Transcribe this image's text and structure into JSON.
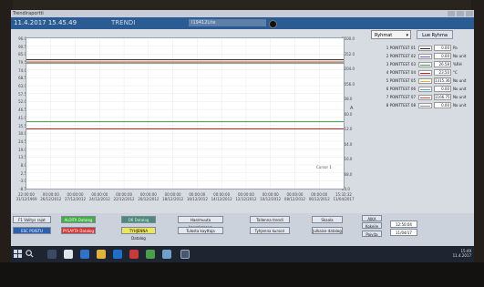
{
  "window": {
    "title": "Trendiraportti"
  },
  "header": {
    "datetime": "11.4.2017  15.45.49",
    "title": "TRENDI",
    "tag": "I19412Lite"
  },
  "controls": {
    "select_label": "Ryhmat",
    "select_arrow": "▾",
    "top_button": "Lue Ryhma"
  },
  "chart_data": {
    "type": "line",
    "title": "",
    "y_left_ticks": [
      "96.0",
      "90.5",
      "85.0",
      "79.5",
      "74.0",
      "68.5",
      "63.0",
      "57.5",
      "52.0",
      "46.5",
      "41.0",
      "35.5",
      "30.0",
      "24.5",
      "19.0",
      "13.5",
      "8.0",
      "2.5",
      "-3.0",
      "-8.5"
    ],
    "y_right_ticks": [
      "1500.0",
      "1352.0",
      "1204.0",
      "1056.0",
      "908.0",
      "760.0",
      "612.0",
      "464.0",
      "316.0",
      "168.0",
      "20.0"
    ],
    "x_ticks": [
      [
        "22:00:00",
        "31/12/1969"
      ],
      [
        "00:00:00",
        "26/12/2012"
      ],
      [
        "00:00:00",
        "27/12/2012"
      ],
      [
        "00:00:00",
        "24/12/2012"
      ],
      [
        "00:00:00",
        "22/12/2012"
      ],
      [
        "00:00:00",
        "20/12/2012"
      ],
      [
        "00:00:00",
        "18/12/2012"
      ],
      [
        "00:00:00",
        "16/12/2012"
      ],
      [
        "00:00:00",
        "14/12/2012"
      ],
      [
        "00:00:00",
        "12/12/2012"
      ],
      [
        "00:00:00",
        "10/12/2012"
      ],
      [
        "00:00:00",
        "08/12/2012"
      ],
      [
        "00:00:00",
        "06/12/2012"
      ],
      [
        "15:32:32",
        "11/04/2017"
      ]
    ],
    "y_axis_side_label": "A",
    "cursor_label": "Cursor 1",
    "series": [
      {
        "color": "#222222",
        "y_level": 81.0
      },
      {
        "color": "#d24a3a",
        "y_level": 79.5
      },
      {
        "color": "#e5b23a",
        "y_level": 79.0
      },
      {
        "color": "#5aa0d0",
        "y_level": 78.5
      },
      {
        "color": "#3f9f3f",
        "y_level": 38.0
      },
      {
        "color": "#c81e1e",
        "y_level": 33.0
      }
    ]
  },
  "legend": [
    {
      "name": "1 POINTTEST 01",
      "value": "0.00",
      "unit": "Pa",
      "color": "#2a2a2a"
    },
    {
      "name": "2 POINTTEST 02",
      "value": "0.00",
      "unit": "No unit",
      "color": "#6b4fd0"
    },
    {
      "name": "3 POINTTEST 03",
      "value": "26.58",
      "unit": "%RH",
      "color": "#3f9f3f"
    },
    {
      "name": "4 POINTTEST 04",
      "value": "23.50",
      "unit": "°C",
      "color": "#c81e1e"
    },
    {
      "name": "5 POINTTEST 05",
      "value": "1315.36",
      "unit": "No unit",
      "color": "#e5b23a"
    },
    {
      "name": "6 POINTTEST 06",
      "value": "0.00",
      "unit": "No unit",
      "color": "#4aa0d0"
    },
    {
      "name": "7 POINTTEST 07",
      "value": "1166.75",
      "unit": "No unit",
      "color": "#d24a3a"
    },
    {
      "name": "8 POINTTEST 08",
      "value": "0.00",
      "unit": "No unit",
      "color": "#8a8a8a"
    }
  ],
  "buttons": {
    "b1": "F1 Valitys rajat",
    "b2": "ALOITA Datalog",
    "b3": "OK Datalog",
    "b4": "ESC POISTU",
    "b5": "PYSAYTA Datalog",
    "b6": "TYHJENNA Datalog",
    "b7": "Hae/muuta kayrakanava",
    "b8": "Tallenna trendi",
    "b9": "Skaala",
    "b10": "Tulosta kayttaja",
    "b11": "Tyhjenna kursori",
    "b12": "Julkaise datalog",
    "b13": "AIKA",
    "b14": "Kokeile",
    "b15": "Paivita",
    "time_val": "12:50:04",
    "date_val": "11/04/17"
  },
  "taskbar": {
    "time": "15:49",
    "date": "11.4.2017"
  }
}
